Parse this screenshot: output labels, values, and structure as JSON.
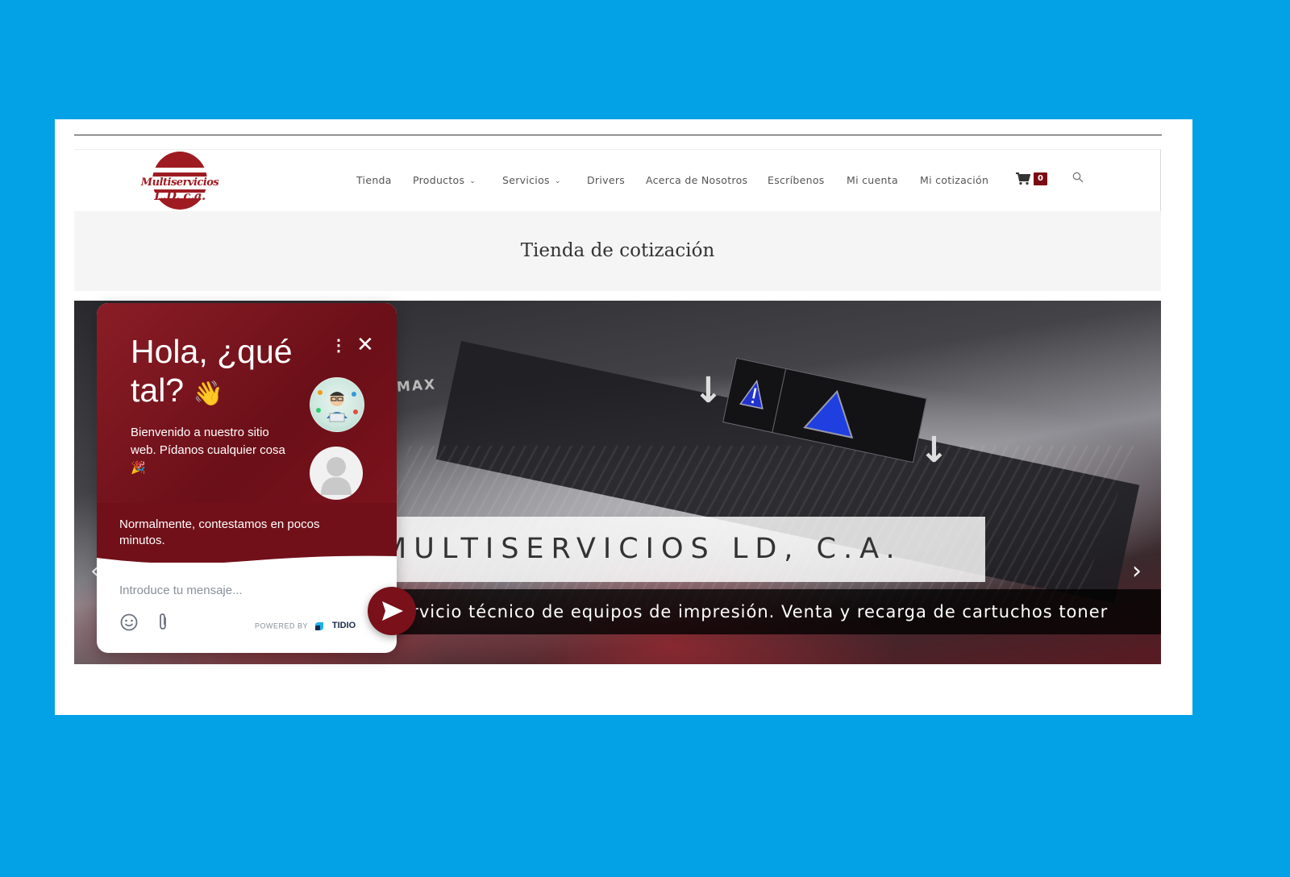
{
  "site": {
    "logo_line1": "Multiservicios",
    "logo_line2": "L.D. c.a."
  },
  "nav": {
    "items": [
      {
        "label": "Tienda"
      },
      {
        "label": "Productos",
        "has_dropdown": true
      },
      {
        "label": "Servicios",
        "has_dropdown": true
      },
      {
        "label": "Drivers"
      },
      {
        "label": "Acerca de Nosotros"
      },
      {
        "label": "Escríbenos"
      },
      {
        "label": "Mi cuenta"
      },
      {
        "label": "Mi cotización"
      }
    ],
    "cart_count": "0",
    "cart_icon": "shopping-cart-icon",
    "search_icon": "search-icon"
  },
  "page": {
    "title": "Tienda de cotización"
  },
  "hero": {
    "max_label": "MAX",
    "caption": "MULTISERVICIOS LD, C.A.",
    "subcaption": "Servicio técnico de equipos de impresión. Venta y recarga de cartuchos toner"
  },
  "chat": {
    "greeting_line1": "Hola, ¿qué",
    "greeting_line2": "tal?",
    "welcome": "Bienvenido a nuestro sitio web. Pídanos cualquier cosa",
    "reply_note": "Normalmente, contestamos en pocos minutos.",
    "input_placeholder": "Introduce tu mensaje...",
    "powered_by": "POWERED BY",
    "brand": "TIDIO"
  },
  "colors": {
    "background": "#03a1e6",
    "brand_red": "#9e1b22",
    "chat_header": "#711019"
  }
}
